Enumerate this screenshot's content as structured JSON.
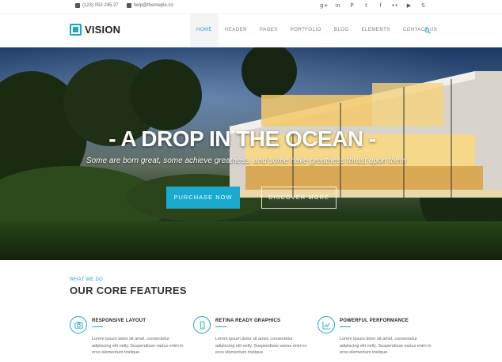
{
  "topbar": {
    "phone": "(123) 053 245 27",
    "email": "help@themeple.co",
    "socials": [
      {
        "icon": "google-plus-icon",
        "glyph": "g+"
      },
      {
        "icon": "linkedin-icon",
        "glyph": "in"
      },
      {
        "icon": "pinterest-icon",
        "glyph": "P"
      },
      {
        "icon": "twitter-icon",
        "glyph": "t"
      },
      {
        "icon": "facebook-icon",
        "glyph": "f"
      },
      {
        "icon": "flickr-icon",
        "glyph": "••"
      },
      {
        "icon": "youtube-icon",
        "glyph": "▶"
      },
      {
        "icon": "skype-icon",
        "glyph": "S"
      }
    ]
  },
  "header": {
    "logo_text": "VISION",
    "nav": [
      "HOME",
      "HEADER",
      "PAGES",
      "PORTFOLIO",
      "BLOG",
      "ELEMENTS",
      "CONTACT US"
    ],
    "active_nav": "HOME"
  },
  "hero": {
    "title": "- A DROP IN THE OCEAN -",
    "subtitle": "Some are born great, some achieve greatness, and some have greatness thrust upon them",
    "primary_button": "PURCHASE NOW",
    "secondary_button": "DISCOVER MORE"
  },
  "features": {
    "eyebrow": "WHAT WE DO",
    "title": "OUR CORE FEATURES",
    "items": [
      {
        "icon": "camera-icon",
        "title": "RESPONSIVE LAYOUT",
        "text": "Lorem ipsum dolor sit amet, consectetur adipiscing elit nelly. Suspendisse varius enim in eros elementum tristique."
      },
      {
        "icon": "phone-icon",
        "title": "RETINA READY GRAPHICS",
        "text": "Lorem ipsum dolor sit amet, consectetur adipiscing elit nelly. Suspendisse varius enim in eros elementum tristique."
      },
      {
        "icon": "chart-icon",
        "title": "POWERFUL PERFORMANCE",
        "text": "Lorem ipsum dolor sit amet, consectetur adipiscing elit nelly. Suspendisse varius enim in eros elementum tristique."
      }
    ]
  },
  "colors": {
    "accent": "#19a6c9"
  }
}
